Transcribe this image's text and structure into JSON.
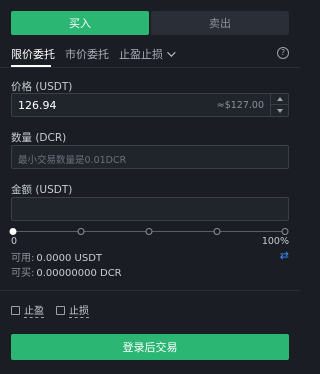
{
  "side": {
    "buy": "买入",
    "sell": "卖出"
  },
  "order_tabs": {
    "limit": "限价委托",
    "market": "市价委托",
    "stop": "止盈止损"
  },
  "help_icon": "?",
  "price": {
    "label": "价格 (USDT)",
    "value": "126.94",
    "ref": "≈$127.00"
  },
  "quantity": {
    "label": "数量 (DCR)",
    "placeholder": "最小交易数量是0.01DCR"
  },
  "amount": {
    "label": "金额 (USDT)"
  },
  "slider": {
    "min": "0",
    "max": "100%",
    "value_fraction": 0
  },
  "info": {
    "available_label": "可用:",
    "available_value": "0.0000 USDT",
    "buyable_label": "可买:",
    "buyable_value": "0.00000000 DCR"
  },
  "options": {
    "take_profit": "止盈",
    "stop_loss": "止损"
  },
  "login_button": "登录后交易",
  "colors": {
    "accent": "#2bb673",
    "background": "#1a1d23",
    "link": "#3d8bfd"
  }
}
